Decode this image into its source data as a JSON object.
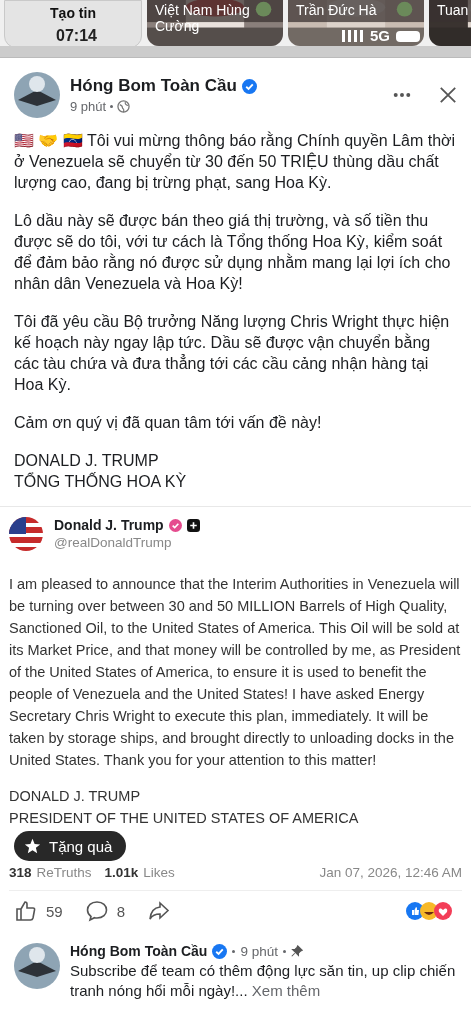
{
  "status_bar": {
    "time": "07:14",
    "network": "5G"
  },
  "stories": [
    {
      "label": "Tạo tin",
      "kind": "create"
    },
    {
      "label": "Việt Nam Hùng Cường",
      "kind": "story"
    },
    {
      "label": "Trần Đức Hà",
      "kind": "story"
    },
    {
      "label": "Tuan",
      "kind": "story"
    }
  ],
  "post": {
    "author": "Hóng Bom Toàn Cầu",
    "verified": true,
    "time": "9 phút",
    "paragraphs": [
      "🇺🇸 🤝 🇻🇪 Tôi vui mừng thông báo rằng Chính quyền Lâm thời ở Venezuela sẽ chuyển từ 30 đến 50 TRIỆU thùng dầu chất lượng cao, đang bị trừng phạt, sang Hoa Kỳ.",
      "Lô dầu này sẽ được bán theo giá thị trường, và số tiền thu được sẽ do tôi, với tư cách là Tổng thống Hoa Kỳ, kiểm soát để đảm bảo rằng nó được sử dụng nhằm mang lại lợi ích cho nhân dân Venezuela và Hoa Kỳ!",
      "Tôi đã yêu cầu Bộ trưởng Năng lượng Chris Wright thực hiện kế hoạch này ngay lập tức. Dầu sẽ được vận chuyển bằng các tàu chứa và đưa thẳng tới các cầu cảng nhận hàng tại Hoa Kỳ.",
      "Cảm ơn quý vị đã quan tâm tới vấn đề này!"
    ],
    "signature": [
      "DONALD J. TRUMP",
      "TỔNG THỐNG HOA KỲ"
    ]
  },
  "embed": {
    "name": "Donald J. Trump",
    "handle": "@realDonaldTrump",
    "text": "I am pleased to announce that the Interim Authorities in Venezuela will be turning over between 30 and 50 MILLION Barrels of High Quality, Sanctioned Oil, to the United States of America. This Oil will be sold at its Market Price, and that money will be controlled by me, as President of the United States of America, to ensure it is used to benefit the people of Venezuela and the United States! I have asked Energy Secretary Chris Wright to execute this plan, immediately. It will be taken by storage ships, and brought directly to unloading docks in the United States. Thank you for your attention to this matter!",
    "signature": [
      "DONALD J. TRUMP",
      "PRESIDENT OF THE UNITED STATES OF AMERICA"
    ],
    "retruths": "318",
    "retruths_label": "ReTruths",
    "likes": "1.01k",
    "likes_label": "Likes",
    "date": "Jan 07, 2026, 12:46 AM"
  },
  "gift_button": "Tặng quà",
  "actions": {
    "likes": "59",
    "comments": "8"
  },
  "comment": {
    "author": "Hóng Bom Toàn Cầu",
    "verified": true,
    "time": "9 phút",
    "pinned": true,
    "text": "Subscribe để team có thêm động lực săn tin, up clip chiến tranh nóng hổi mỗi ngày!...",
    "more": "Xem thêm"
  }
}
